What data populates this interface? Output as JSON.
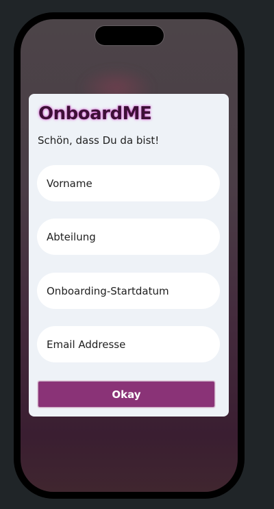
{
  "app": {
    "brand": "OnboardME",
    "subtitle": "Schön, dass Du da bist!"
  },
  "form": {
    "fields": [
      {
        "placeholder": "Vorname"
      },
      {
        "placeholder": "Abteilung"
      },
      {
        "placeholder": "Onboarding-Startdatum"
      },
      {
        "placeholder": "Email Addresse"
      }
    ],
    "submit_label": "Okay"
  },
  "colors": {
    "brand_text": "#3d1036",
    "brand_glow": "#d96bd6",
    "button": "#8a3377",
    "card": "#eef2f7",
    "page_background": "#202528"
  }
}
